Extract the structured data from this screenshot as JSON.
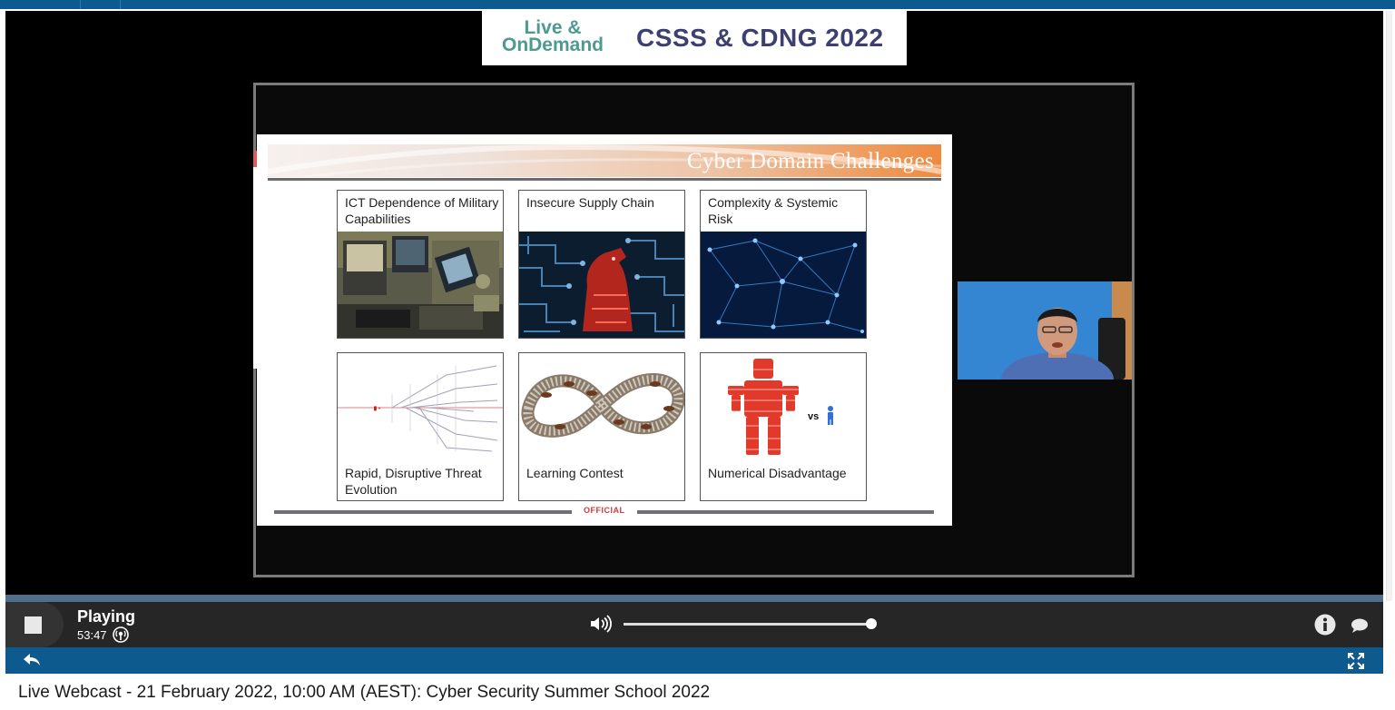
{
  "banner": {
    "live_line1": "Live &",
    "live_line2": "OnDemand",
    "title": "CSSS & CDNG 2022"
  },
  "slide": {
    "title": "Cyber Domain Challenges",
    "cards": [
      {
        "label": "ICT Dependence of Military Capabilities"
      },
      {
        "label": "Insecure Supply Chain"
      },
      {
        "label": "Complexity & Systemic Risk"
      },
      {
        "label": "Rapid, Disruptive Threat Evolution"
      },
      {
        "label": "Learning Contest"
      },
      {
        "label": "Numerical Disadvantage"
      }
    ],
    "vs_label": "vs",
    "footer_marking": "OFFICIAL"
  },
  "player": {
    "status": "Playing",
    "elapsed": "53:47",
    "volume_fraction": 0.99,
    "icons": [
      "stop-icon",
      "broadcast-icon",
      "volume-icon",
      "info-icon",
      "chat-icon",
      "back-arrow-icon",
      "fullscreen-icon"
    ]
  },
  "page": {
    "caption": "Live Webcast - 21 February 2022, 10:00 AM (AEST): Cyber Security Summer School 2022"
  },
  "colors": {
    "brand_blue": "#0d5a8f",
    "banner_teal": "#4d9a8f",
    "banner_navy": "#3c3f6f",
    "slide_accent_orange": "#ee8a3f",
    "official_red": "#d13a3a"
  }
}
